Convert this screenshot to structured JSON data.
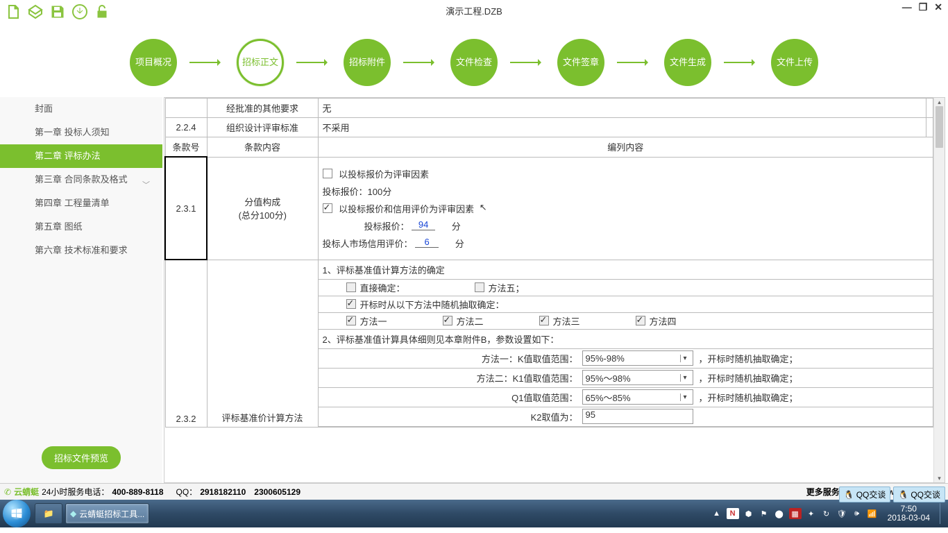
{
  "window": {
    "title": "演示工程.DZB"
  },
  "titlebar_icons": [
    "new-file-icon",
    "open-file-icon",
    "save-icon",
    "download-icon",
    "unlock-icon"
  ],
  "steps": [
    {
      "label": "项目概况",
      "active": false
    },
    {
      "label": "招标正文",
      "active": true
    },
    {
      "label": "招标附件",
      "active": false
    },
    {
      "label": "文件检查",
      "active": false
    },
    {
      "label": "文件签章",
      "active": false
    },
    {
      "label": "文件生成",
      "active": false
    },
    {
      "label": "文件上传",
      "active": false
    }
  ],
  "sidebar": {
    "items": [
      {
        "label": "封面",
        "active": false,
        "expandable": false
      },
      {
        "label": "第一章  投标人须知",
        "active": false,
        "expandable": false
      },
      {
        "label": "第二章  评标办法",
        "active": true,
        "expandable": false
      },
      {
        "label": "第三章  合同条款及格式",
        "active": false,
        "expandable": true
      },
      {
        "label": "第四章  工程量清单",
        "active": false,
        "expandable": false
      },
      {
        "label": "第五章  图纸",
        "active": false,
        "expandable": false
      },
      {
        "label": "第六章  技术标准和要求",
        "active": false,
        "expandable": false
      }
    ],
    "preview_label": "招标文件预览"
  },
  "top_rows": {
    "r1_col2": "经批准的其他要求",
    "r1_col3": "无",
    "r2_col1": "2.2.4",
    "r2_col2": "组织设计评审标准",
    "r2_col3": "不采用"
  },
  "headers": {
    "clause": "条款号",
    "content": "条款内容",
    "body": "编列内容"
  },
  "row231": {
    "clause_no": "2.3.1",
    "content_line1": "分值构成",
    "content_line2": "(总分100分)",
    "chk_price_label": "以投标报价为评审因素",
    "price_score_line": "投标报价：100分",
    "chk_price_credit_label": "以投标报价和信用评价为评审因素",
    "bid_price_label": "投标报价：",
    "bid_price_value": "94",
    "score_unit": "分",
    "credit_label": "投标人市场信用评价：",
    "credit_value": "6"
  },
  "row232": {
    "section1_title": "1、评标基准值计算方法的确定",
    "direct_label": "直接确定：",
    "method5_label": "方法五；",
    "random_label": "开标时从以下方法中随机抽取确定：",
    "m1": "方法一",
    "m2": "方法二",
    "m3": "方法三",
    "m4": "方法四",
    "section2_title": "2、评标基准值计算具体细则见本章附件B，参数设置如下：",
    "p1_label": "方法一：K值取值范围：",
    "p1_value": "95%-98%",
    "p1_post": "，开标时随机抽取确定；",
    "p2_label": "方法二：K1值取值范围：",
    "p2_value": "95%～98%",
    "p2_post": "，开标时随机抽取确定；",
    "p3_label": "Q1值取值范围：",
    "p3_value": "65%～85%",
    "p3_post": "，开标时随机抽取确定；",
    "p4_label": "K2取值为：",
    "p4_value": "95",
    "clause_no": "2.3.2",
    "content_partial": "评标基准价计算方法"
  },
  "footer": {
    "brand": "云蜻蜓",
    "hotline_label": "24小时服务电话：",
    "hotline": "400-889-8118",
    "qq_label": "QQ：",
    "qq1": "2918182110",
    "qq2": "2300605129",
    "more_label": "更多服务请关注：",
    "more_url": "www.yqtsoft.com",
    "qq_chat": "QQ交谈"
  },
  "taskbar": {
    "app_label": "云蜻蜓招标工具...",
    "time": "7:50",
    "date": "2018-03-04"
  }
}
